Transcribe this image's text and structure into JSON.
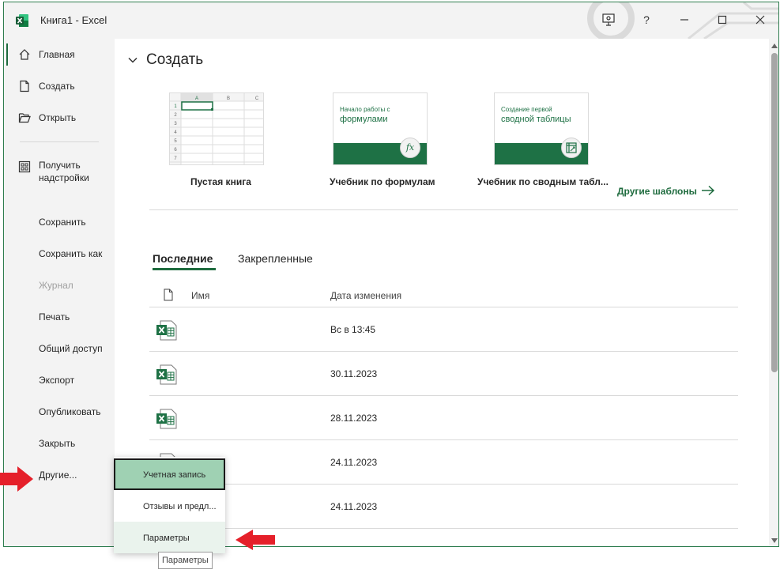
{
  "window": {
    "title": "Книга1  -  Excel",
    "help": "?"
  },
  "sidebar": {
    "items": [
      {
        "label": "Главная",
        "icon": "home-icon"
      },
      {
        "label": "Создать",
        "icon": "new-document-icon"
      },
      {
        "label": "Открыть",
        "icon": "folder-open-icon"
      },
      {
        "label": "Получить надстройки",
        "icon": "addins-grid-icon"
      },
      {
        "label": "Сохранить"
      },
      {
        "label": "Сохранить как"
      },
      {
        "label": "Журнал"
      },
      {
        "label": "Печать"
      },
      {
        "label": "Общий доступ"
      },
      {
        "label": "Экспорт"
      },
      {
        "label": "Опубликовать"
      },
      {
        "label": "Закрыть"
      },
      {
        "label": "Другие..."
      }
    ]
  },
  "create": {
    "title": "Создать",
    "templates": [
      {
        "label": "Пустая книга",
        "grid_cols": [
          "A",
          "B",
          "C"
        ],
        "grid_rows": [
          "1",
          "2",
          "3",
          "4",
          "5",
          "6",
          "7"
        ]
      },
      {
        "label": "Учебник по формулам",
        "thumb_small": "Начало работы с",
        "thumb_big": "формулами",
        "badge": "fx"
      },
      {
        "label": "Учебник по сводным табл...",
        "thumb_small": "Создание первой",
        "thumb_big": "сводной таблицы"
      }
    ],
    "other_templates": "Другие шаблоны"
  },
  "files": {
    "tabs": [
      "Последние",
      "Закрепленные"
    ],
    "col_name": "Имя",
    "col_date": "Дата изменения",
    "rows": [
      {
        "date": "Вс в 13:45"
      },
      {
        "date": "30.11.2023"
      },
      {
        "date": "28.11.2023"
      },
      {
        "date": "24.11.2023"
      },
      {
        "date": "24.11.2023"
      }
    ]
  },
  "popup": {
    "items": [
      "Учетная запись",
      "Отзывы и предл...",
      "Параметры"
    ]
  },
  "tooltip": "Параметры",
  "colors": {
    "accent": "#1e6b3e",
    "excel_green": "#1e7145",
    "selected_bg": "#9fd1b3",
    "arrow_red": "#e5202a"
  }
}
